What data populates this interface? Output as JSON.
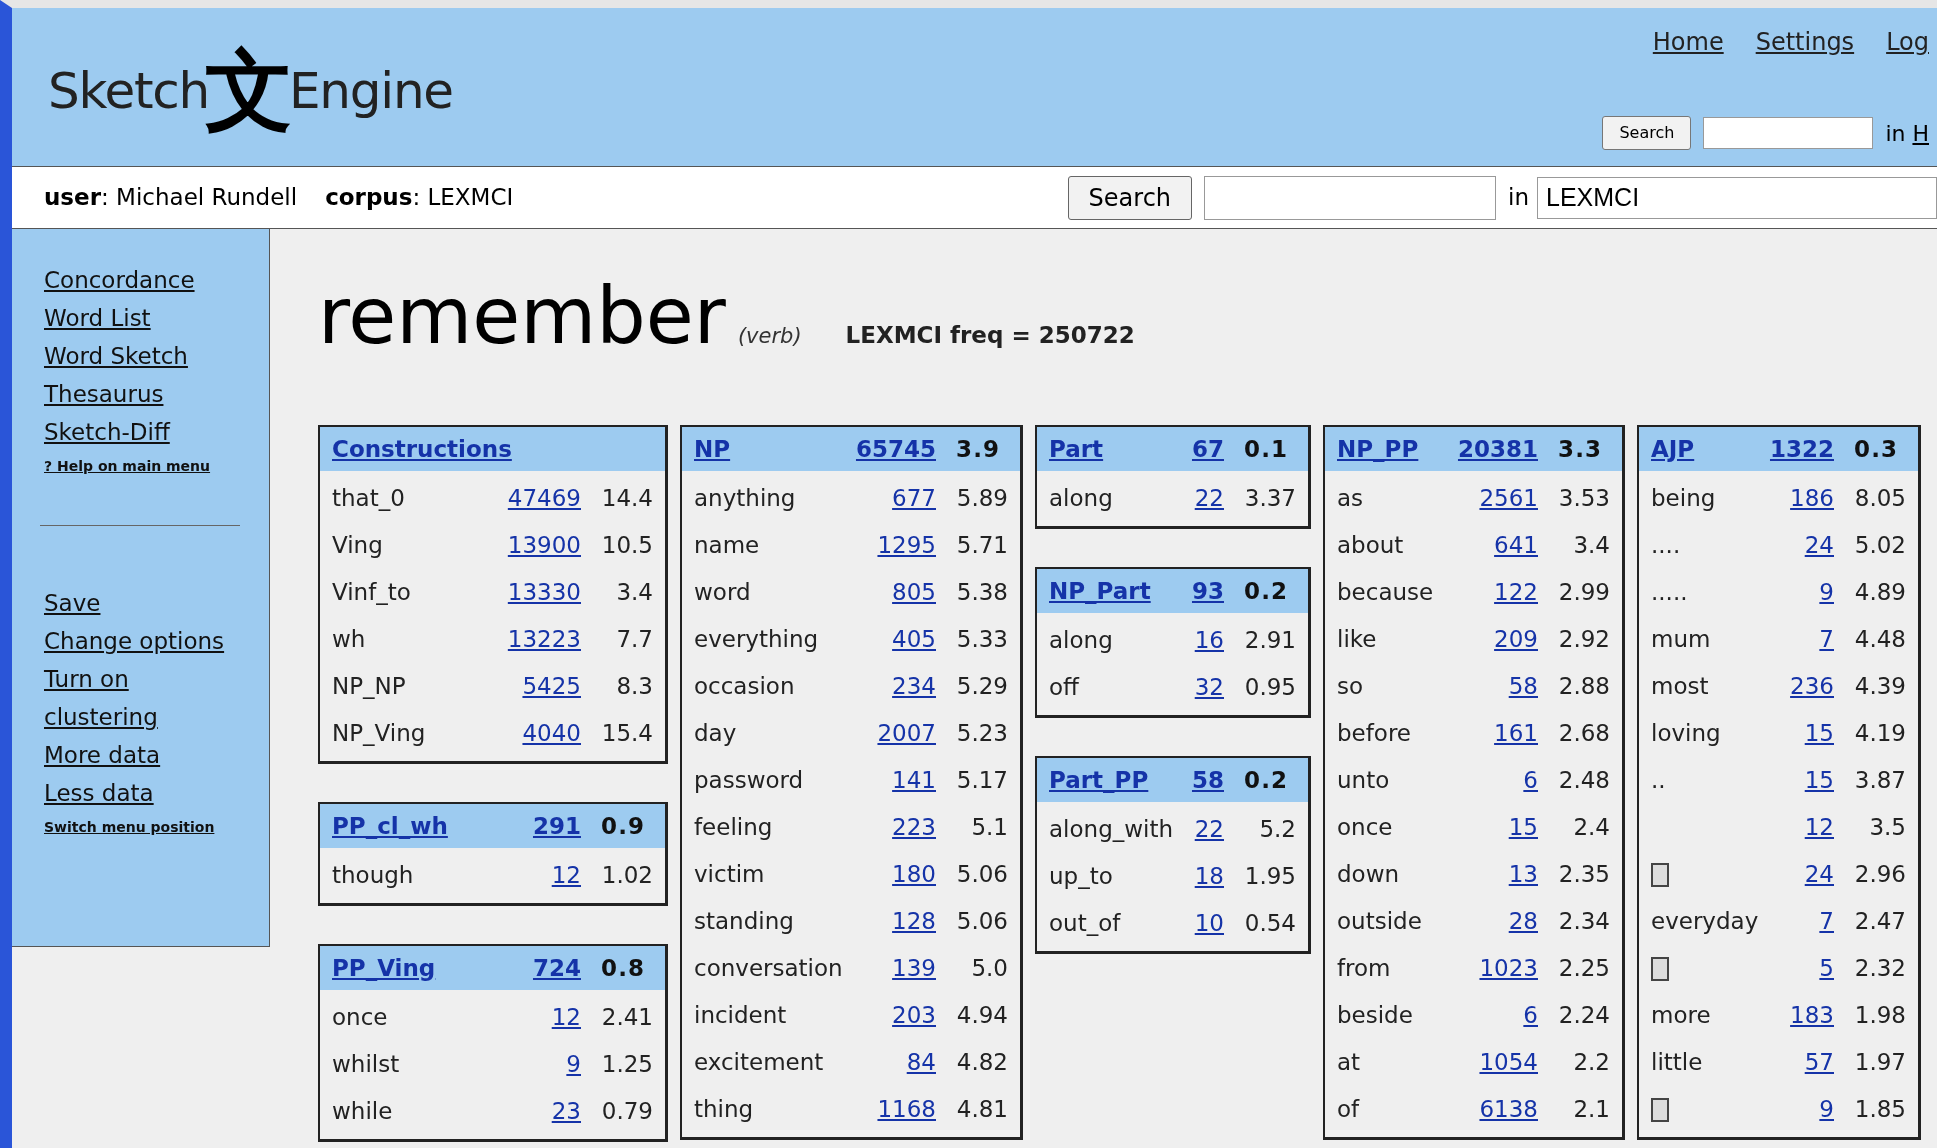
{
  "logo": {
    "left": "Sketch",
    "glyph": "文",
    "right": "Engine"
  },
  "top_links": [
    "Home",
    "Settings",
    "Log"
  ],
  "top_search": {
    "button": "Search",
    "in_label": "in",
    "scope_link": "H"
  },
  "user_bar": {
    "user": "**user**: Michael Rundell",
    "corpus": "**corpus**: LEXMCI",
    "search_button": "Search",
    "in_label": "in",
    "corpus_field": "LEXMCI"
  },
  "sidebar": {
    "groups": [
      [
        {
          "label": "Concordance",
          "kind": "link"
        },
        {
          "label": "Word List",
          "kind": "link"
        },
        {
          "label": "Word Sketch",
          "kind": "link"
        },
        {
          "label": "Thesaurus",
          "kind": "link"
        },
        {
          "label": "Sketch-Diff",
          "kind": "link"
        },
        {
          "label": "? Help on main menu",
          "kind": "small"
        }
      ],
      [
        {
          "label": "Save",
          "kind": "link"
        },
        {
          "label": "Change options",
          "kind": "link"
        },
        {
          "label": "Turn on clustering",
          "kind": "link"
        },
        {
          "label": "More data",
          "kind": "link"
        },
        {
          "label": "Less data",
          "kind": "link"
        },
        {
          "label": "Switch menu position",
          "kind": "small"
        }
      ]
    ]
  },
  "heading": {
    "word": "remember",
    "pos": "(verb)",
    "freq": "LEXMCI freq = 250722"
  },
  "columns": [
    [
      {
        "name": "Constructions",
        "rows": [
          {
            "word": "that_0",
            "count": "47469",
            "score": "14.4"
          },
          {
            "word": "Ving",
            "count": "13900",
            "score": "10.5"
          },
          {
            "word": "Vinf_to",
            "count": "13330",
            "score": "3.4"
          },
          {
            "word": "wh",
            "count": "13223",
            "score": "7.7"
          },
          {
            "word": "NP_NP",
            "count": "5425",
            "score": "8.3"
          },
          {
            "word": "NP_Ving",
            "count": "4040",
            "score": "15.4"
          }
        ]
      },
      {
        "name": "PP_cl_wh",
        "count": "291",
        "score": "0.9",
        "rows": [
          {
            "word": "though",
            "count": "12",
            "score": "1.02"
          }
        ]
      },
      {
        "name": "PP_Ving",
        "count": "724",
        "score": "0.8",
        "rows": [
          {
            "word": "once",
            "count": "12",
            "score": "2.41"
          },
          {
            "word": "whilst",
            "count": "9",
            "score": "1.25"
          },
          {
            "word": "while",
            "count": "23",
            "score": "0.79"
          }
        ]
      }
    ],
    [
      {
        "name": "NP",
        "count": "65745",
        "score": "3.9",
        "rows": [
          {
            "word": "anything",
            "count": "677",
            "score": "5.89"
          },
          {
            "word": "name",
            "count": "1295",
            "score": "5.71"
          },
          {
            "word": "word",
            "count": "805",
            "score": "5.38"
          },
          {
            "word": "everything",
            "count": "405",
            "score": "5.33"
          },
          {
            "word": "occasion",
            "count": "234",
            "score": "5.29"
          },
          {
            "word": "day",
            "count": "2007",
            "score": "5.23"
          },
          {
            "word": "password",
            "count": "141",
            "score": "5.17"
          },
          {
            "word": "feeling",
            "count": "223",
            "score": "5.1"
          },
          {
            "word": "victim",
            "count": "180",
            "score": "5.06"
          },
          {
            "word": "standing",
            "count": "128",
            "score": "5.06"
          },
          {
            "word": "conversation",
            "count": "139",
            "score": "5.0"
          },
          {
            "word": "incident",
            "count": "203",
            "score": "4.94"
          },
          {
            "word": "excitement",
            "count": "84",
            "score": "4.82"
          },
          {
            "word": "thing",
            "count": "1168",
            "score": "4.81"
          }
        ]
      }
    ],
    [
      {
        "name": "Part",
        "count": "67",
        "score": "0.1",
        "rows": [
          {
            "word": "along",
            "count": "22",
            "score": "3.37"
          }
        ]
      },
      {
        "name": "NP_Part",
        "count": "93",
        "score": "0.2",
        "rows": [
          {
            "word": "along",
            "count": "16",
            "score": "2.91"
          },
          {
            "word": "off",
            "count": "32",
            "score": "0.95"
          }
        ]
      },
      {
        "name": "Part_PP",
        "count": "58",
        "score": "0.2",
        "rows": [
          {
            "word": "along_with",
            "count": "22",
            "score": "5.2"
          },
          {
            "word": "up_to",
            "count": "18",
            "score": "1.95"
          },
          {
            "word": "out_of",
            "count": "10",
            "score": "0.54"
          }
        ]
      }
    ],
    [
      {
        "name": "NP_PP",
        "count": "20381",
        "score": "3.3",
        "rows": [
          {
            "word": "as",
            "count": "2561",
            "score": "3.53"
          },
          {
            "word": "about",
            "count": "641",
            "score": "3.4"
          },
          {
            "word": "because",
            "count": "122",
            "score": "2.99"
          },
          {
            "word": "like",
            "count": "209",
            "score": "2.92"
          },
          {
            "word": "so",
            "count": "58",
            "score": "2.88"
          },
          {
            "word": "before",
            "count": "161",
            "score": "2.68"
          },
          {
            "word": "unto",
            "count": "6",
            "score": "2.48"
          },
          {
            "word": "once",
            "count": "15",
            "score": "2.4"
          },
          {
            "word": "down",
            "count": "13",
            "score": "2.35"
          },
          {
            "word": "outside",
            "count": "28",
            "score": "2.34"
          },
          {
            "word": "from",
            "count": "1023",
            "score": "2.25"
          },
          {
            "word": "beside",
            "count": "6",
            "score": "2.24"
          },
          {
            "word": "at",
            "count": "1054",
            "score": "2.2"
          },
          {
            "word": "of",
            "count": "6138",
            "score": "2.1"
          }
        ]
      }
    ],
    [
      {
        "name": "AJP",
        "count": "1322",
        "score": "0.3",
        "rows": [
          {
            "word": "being",
            "count": "186",
            "score": "8.05"
          },
          {
            "word": "....",
            "count": "24",
            "score": "5.02"
          },
          {
            "word": ".....",
            "count": "9",
            "score": "4.89"
          },
          {
            "word": "mum",
            "count": "7",
            "score": "4.48"
          },
          {
            "word": "most",
            "count": "236",
            "score": "4.39"
          },
          {
            "word": "loving",
            "count": "15",
            "score": "4.19"
          },
          {
            "word": "..",
            "count": "15",
            "score": "3.87"
          },
          {
            "kind": "blank",
            "count": "12",
            "score": "3.5"
          },
          {
            "kind": "glyph",
            "count": "24",
            "score": "2.96"
          },
          {
            "word": "everyday",
            "count": "7",
            "score": "2.47"
          },
          {
            "kind": "glyph",
            "count": "5",
            "score": "2.32"
          },
          {
            "word": "more",
            "count": "183",
            "score": "1.98"
          },
          {
            "word": "little",
            "count": "57",
            "score": "1.97"
          },
          {
            "kind": "glyph",
            "count": "9",
            "score": "1.85"
          }
        ]
      }
    ]
  ]
}
